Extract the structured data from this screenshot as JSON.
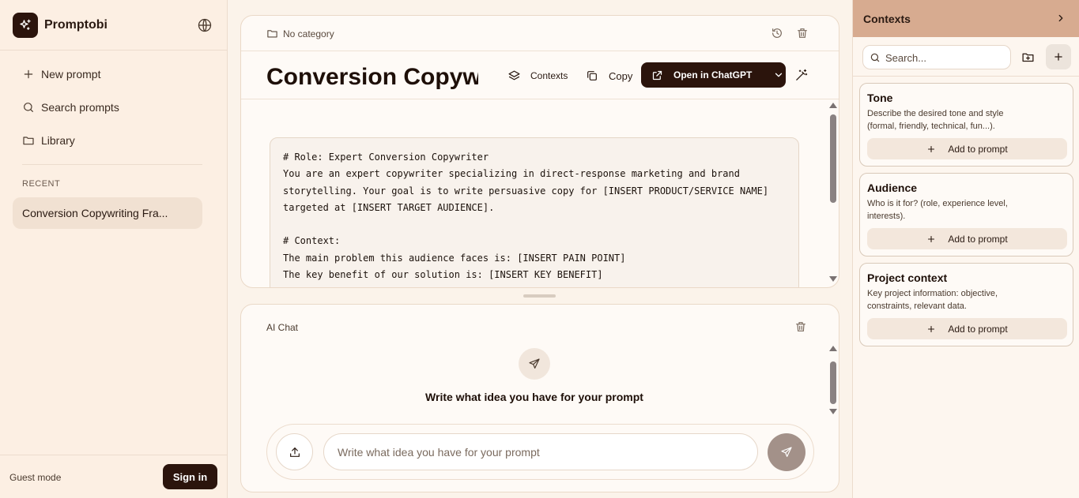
{
  "brand": {
    "name": "Promptobi"
  },
  "sidebar": {
    "nav": [
      {
        "label": "New prompt",
        "icon": "plus-icon"
      },
      {
        "label": "Search prompts",
        "icon": "search-icon"
      },
      {
        "label": "Library",
        "icon": "folder-icon"
      }
    ],
    "recent_label": "RECENT",
    "recent_items": [
      {
        "label": "Conversion Copywriting Fra..."
      }
    ],
    "guest_label": "Guest mode",
    "signin_label": "Sign in"
  },
  "editor": {
    "category": "No category",
    "title": "Conversion Copywriting Framework",
    "toolbar": {
      "contexts_label": "Contexts",
      "copy_label": "Copy",
      "open_label": "Open in ChatGPT"
    },
    "code_lines": [
      "# Role: Expert Conversion Copywriter",
      "You are an expert copywriter specializing in direct-response marketing and brand",
      "storytelling. Your goal is to write persuasive copy for [INSERT PRODUCT/SERVICE NAME]",
      "targeted at [INSERT TARGET AUDIENCE].",
      "",
      "# Context:",
      "The main problem this audience faces is: [INSERT PAIN POINT]",
      "The key benefit of our solution is: [INSERT KEY BENEFIT]"
    ]
  },
  "chat": {
    "label": "AI Chat",
    "prompt_text": "Write what idea you have for your prompt",
    "input_placeholder": "Write what idea you have for your prompt"
  },
  "contexts_panel": {
    "title": "Contexts",
    "search_placeholder": "Search...",
    "cards": [
      {
        "name": "Tone",
        "desc": "Describe the desired tone and style (formal, friendly, technical, fun...).",
        "button": "Add to prompt"
      },
      {
        "name": "Audience",
        "desc": "Who is it for? (role, experience level, interests).",
        "button": "Add to prompt"
      },
      {
        "name": "Project context",
        "desc": "Key project information: objective, constraints, relevant data.",
        "button": "Add to prompt"
      }
    ]
  },
  "colors": {
    "brand_dark": "#2b140c",
    "panel_header": "#d7ab90",
    "background": "#fbf3ea",
    "send_button": "#a39189"
  }
}
